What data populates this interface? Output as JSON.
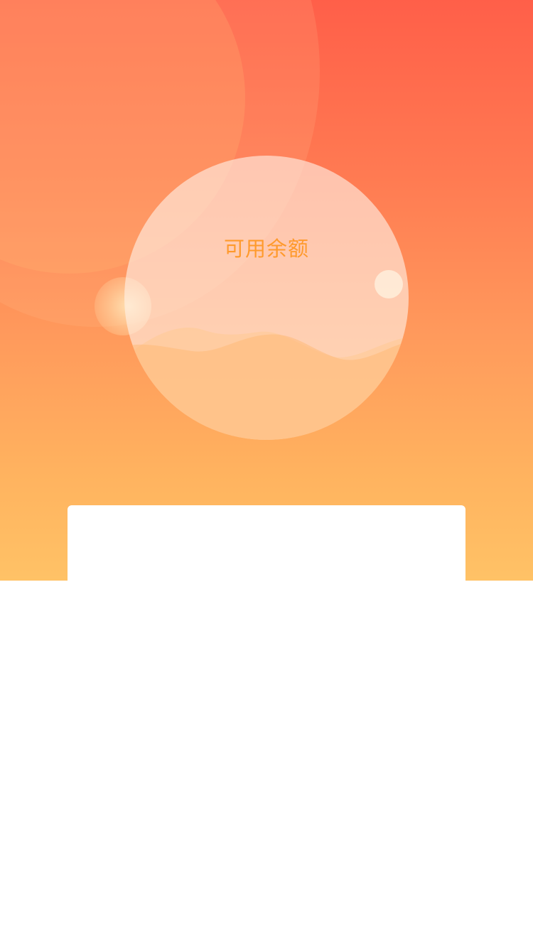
{
  "balance": {
    "title": "可用余额"
  },
  "colors": {
    "gradient_top": "#ff5f49",
    "gradient_bottom": "#ffc266",
    "title_text": "#ff9a2c",
    "card_background": "#ffffff"
  }
}
